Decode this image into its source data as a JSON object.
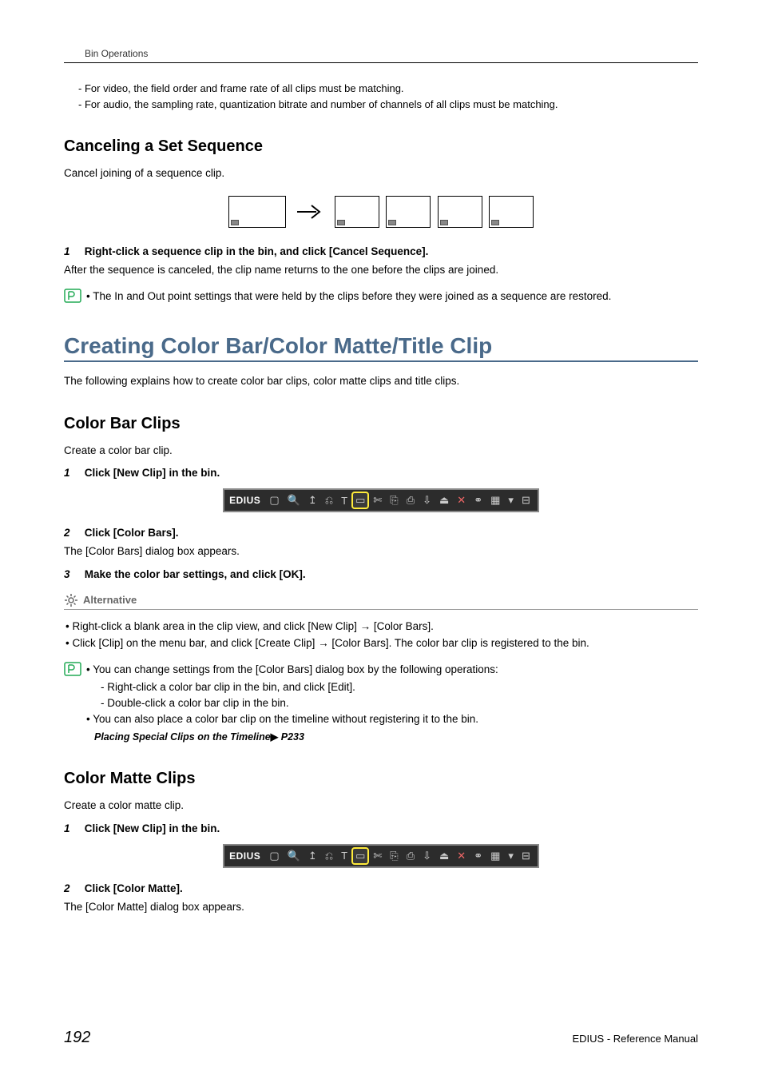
{
  "header": {
    "breadcrumb": "Bin Operations"
  },
  "intro_bullets": {
    "b1": "For video, the field order and frame rate of all clips must be matching.",
    "b2": "For audio, the sampling rate, quantization bitrate and number of channels of all clips must be matching."
  },
  "cancel": {
    "heading": "Canceling a Set Sequence",
    "desc": "Cancel joining of a sequence clip.",
    "step1": "Right-click a sequence clip in the bin, and click [Cancel Sequence].",
    "after": "After the sequence is canceled, the clip name returns to the one before the clips are joined.",
    "note": "The In and Out point settings that were held by the clips before they were joined as a sequence are restored."
  },
  "chapter": {
    "title": "Creating Color Bar/Color Matte/Title Clip",
    "desc": "The following explains how to create color bar clips, color matte clips and title clips."
  },
  "colorbar": {
    "heading": "Color Bar Clips",
    "desc": "Create a color bar clip.",
    "step1": "Click [New Clip] in the bin.",
    "step2": "Click [Color Bars].",
    "step2_after": "The [Color Bars] dialog box appears.",
    "step3": "Make the color bar settings, and click [OK].",
    "alt_title": "Alternative",
    "alt1_a": "Right-click a blank area in the clip view, and click [New Clip] ",
    "alt1_b": " [Color Bars].",
    "alt2_a": "Click [Clip] on the menu bar, and click [Create Clip] ",
    "alt2_b": " [Color Bars]. The color bar clip is registered to the bin.",
    "note1": "You can change settings from the [Color Bars] dialog box by the following operations:",
    "note1_d1": "Right-click a color bar clip in the bin, and click [Edit].",
    "note1_d2": "Double-click a color bar clip in the bin.",
    "note2": "You can also place a color bar clip on the timeline without registering it to the bin.",
    "xref": "Placing Special Clips on the Timeline",
    "xref_page": " P233"
  },
  "colormatte": {
    "heading": "Color Matte Clips",
    "desc": "Create a color matte clip.",
    "step1": "Click [New Clip] in the bin.",
    "step2": "Click [Color Matte].",
    "step2_after": "The [Color Matte] dialog box appears."
  },
  "toolbar": {
    "logo": "EDIUS"
  },
  "steps": {
    "n1": "1",
    "n2": "2",
    "n3": "3"
  },
  "arrow": "→",
  "footer": {
    "page": "192",
    "right": "EDIUS - Reference Manual"
  }
}
